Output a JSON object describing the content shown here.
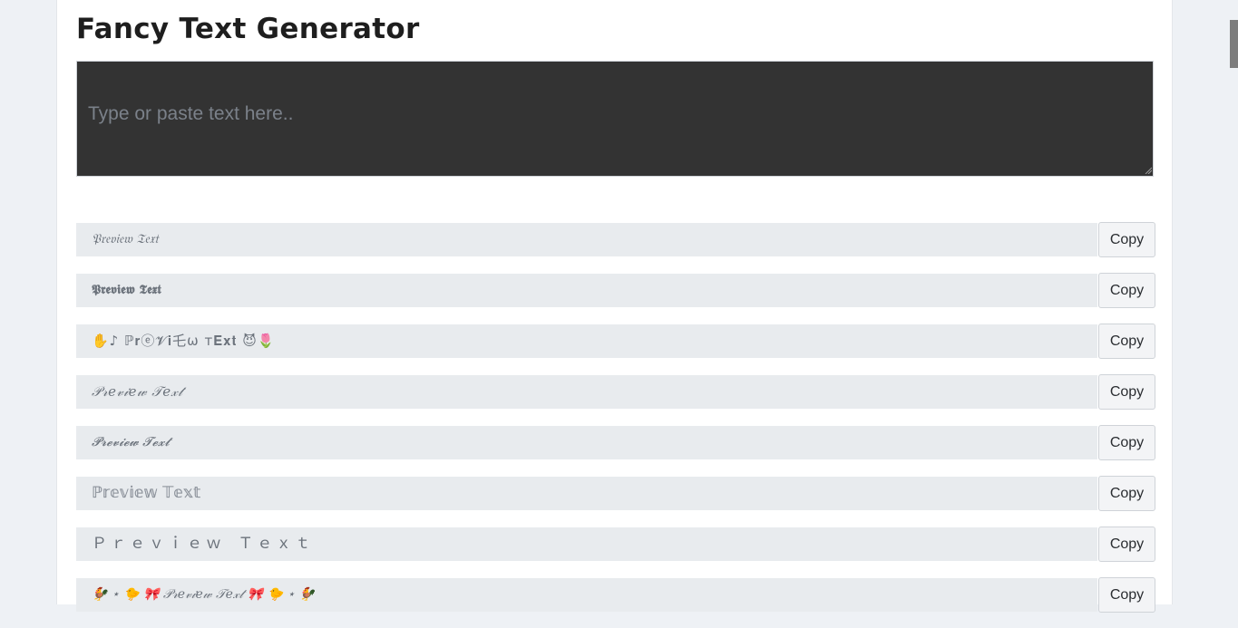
{
  "page": {
    "title": "Fancy Text Generator"
  },
  "input": {
    "placeholder": "Type or paste text here..",
    "value": ""
  },
  "copy_label": "Copy",
  "styles": [
    {
      "style": "fraktur",
      "preview": "𝔓𝔯𝔢𝔳𝔦𝔢𝔴 𝔗𝔢𝔵𝔱"
    },
    {
      "style": "bold-fraktur",
      "preview": "𝕻𝖗𝖊𝖛𝖎𝖊𝖜 𝕿𝖊𝖝𝖙"
    },
    {
      "style": "mixed",
      "preview": "✋♪ ℙ𝐫ⓔ𝓥𝐢乇ω т𝐄𝐱𝐭 😈🌷"
    },
    {
      "style": "script",
      "preview": "𝒫𝓇𝑒𝓋𝒾𝑒𝓌 𝒯𝑒𝓍𝓉"
    },
    {
      "style": "script2",
      "preview": "𝓟𝓻𝓮𝓿𝓲𝓮𝔀 𝓣𝓮𝔁𝓽"
    },
    {
      "style": "double",
      "preview": "ℙ𝕣𝕖𝕧𝕚𝕖𝕨 𝕋𝕖𝕩𝕥"
    },
    {
      "style": "wide",
      "preview": "Ｐｒｅｖｉｅｗ Ｔｅｘｔ"
    },
    {
      "style": "deco",
      "preview": "🐓 ⋆ 🐤  🎀  𝒫𝓇𝑒𝓋𝒾𝑒𝓌 𝒯𝑒𝓍𝓉  🎀  🐤 ⋆ 🐓"
    }
  ]
}
